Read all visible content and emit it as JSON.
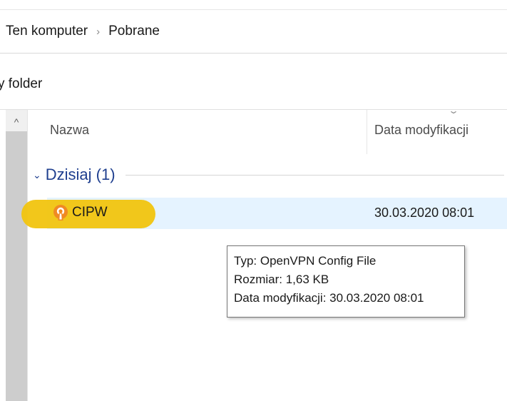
{
  "breadcrumb": {
    "items": [
      "Ten komputer",
      "Pobrane"
    ],
    "separator": "›"
  },
  "toolbar": {
    "new_folder_label": "y folder"
  },
  "columns": {
    "name": "Nazwa",
    "date_modified": "Data modyfikacji",
    "sort_glyph": "⌄"
  },
  "nav": {
    "scroll_up_glyph": "^"
  },
  "groups": [
    {
      "label": "Dzisiaj (1)",
      "chevron": "⌄",
      "files": [
        {
          "name": "CIPW",
          "date_modified": "30.03.2020 08:01",
          "icon": "openvpn-icon"
        }
      ]
    }
  ],
  "tooltip": {
    "type_line": "Typ: OpenVPN Config File",
    "size_line": "Rozmiar: 1,63 KB",
    "date_line": "Data modyfikacji: 30.03.2020 08:01"
  },
  "colors": {
    "group_header": "#1f3f8f",
    "row_selected": "#e5f3ff",
    "highlight": "#f1c40f",
    "openvpn_orange": "#f08a24"
  }
}
